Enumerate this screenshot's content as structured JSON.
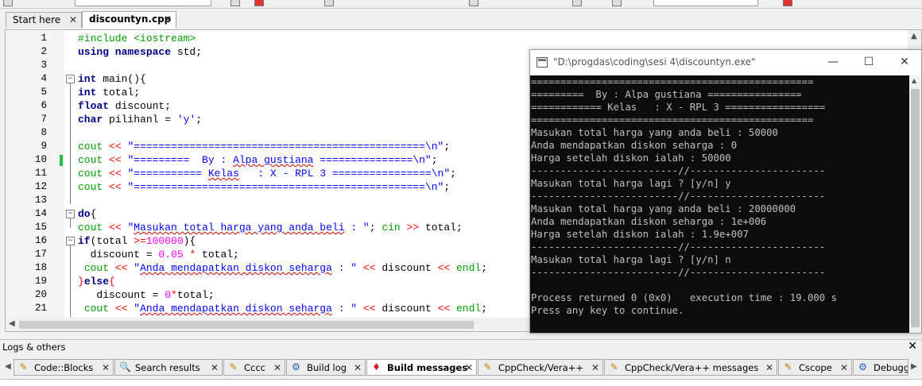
{
  "editor_tabs": [
    {
      "label": "Start here",
      "close": "✕"
    },
    {
      "label": "discountyn.cpp",
      "close": "✕"
    }
  ],
  "line_numbers": [
    "1",
    "2",
    "3",
    "4",
    "5",
    "6",
    "7",
    "8",
    "9",
    "10",
    "11",
    "12",
    "13",
    "14",
    "15",
    "16",
    "17",
    "18",
    "19",
    "20",
    "21"
  ],
  "code": {
    "l1": "#include <iostream>",
    "l2_kw": "using namespace",
    "l2_rest": " std;",
    "l4_kw": "int",
    "l4_rest": " main(){",
    "l5_kw": "int",
    "l5_rest": " total;",
    "l6_kw": "float",
    "l6_rest": " discount;",
    "l7_kw": "char",
    "l7_rest": " pilihanl = ",
    "l7_str": "'y'",
    "l7_end": ";",
    "cout": "cout",
    "ins": " << ",
    "l9_str": "\"===============================================\\n\"",
    "l10_str_a": "\"=========  By : ",
    "l10_sq": "Alpa gustiana",
    "l10_str_b": " ===============\\n\"",
    "l11_str_a": "\"=========== ",
    "l11_sq": "Kelas",
    "l11_str_b": "   : X - RPL 3 ================\\n\"",
    "l12_str": "\"===============================================\\n\"",
    "semi": ";",
    "l14_kw": "do",
    "l14_rest": "{",
    "l15_str_a": "\"",
    "l15_sq": "Masukan total harga yang anda beli",
    "l15_str_b": " : \"",
    "l15_mid": "; ",
    "l15_cin": "cin",
    "l15_ext": " >> ",
    "l15_end": "total;",
    "l16_kw": "if",
    "l16_a": "(total ",
    "l16_op": ">=",
    "l16_num": "100000",
    "l16_b": "){",
    "l17_a": "  discount = ",
    "l17_num": "0.05",
    "l17_op": " * ",
    "l17_b": "total;",
    "l18_pre": " ",
    "l18_str_a": "\"",
    "l18_sq": "Anda mendapatkan diskon seharga",
    "l18_str_b": " : \"",
    "l18_mid": "discount",
    "l18_endl": "endl",
    "l19_a": "}",
    "l19_kw": "else",
    "l19_b": "{",
    "l20_a": "   discount = ",
    "l20_num": "0",
    "l20_op": "*",
    "l20_b": "total;"
  },
  "console": {
    "title": "\"D:\\progdas\\coding\\sesi 4\\discountyn.exe\"",
    "minimize": "—",
    "maximize": "☐",
    "close": "✕",
    "lines": [
      "================================================",
      "=========  By : Alpa gustiana ================",
      "============ Kelas   : X - RPL 3 =================",
      "================================================",
      "Masukan total harga yang anda beli : 50000",
      "Anda mendapatkan diskon seharga : 0",
      "Harga setelah diskon ialah : 50000",
      "-------------------------//-----------------------",
      "Masukan total harga lagi ? [y/n] y",
      "-------------------------//-----------------------",
      "Masukan total harga yang anda beli : 20000000",
      "Anda mendapatkan diskon seharga : 1e+006",
      "Harga setelah diskon ialah : 1.9e+007",
      "-------------------------//-----------------------",
      "Masukan total harga lagi ? [y/n] n",
      "-------------------------//-----------------------",
      "",
      "Process returned 0 (0x0)   execution time : 19.000 s",
      "Press any key to continue."
    ]
  },
  "logs": {
    "title": "Logs & others",
    "close": "✕",
    "tabs": [
      {
        "label": "Code::Blocks",
        "icon": "✎"
      },
      {
        "label": "Search results",
        "icon": "🔍"
      },
      {
        "label": "Cccc",
        "icon": "✎"
      },
      {
        "label": "Build log",
        "icon": "⚙"
      },
      {
        "label": "Build messages",
        "icon": "♦"
      },
      {
        "label": "CppCheck/Vera++",
        "icon": "✎"
      },
      {
        "label": "CppCheck/Vera++ messages",
        "icon": "✎"
      },
      {
        "label": "Cscope",
        "icon": "✎"
      },
      {
        "label": "Debugge",
        "icon": "⚙"
      }
    ],
    "tab_close": "✕",
    "scroll_left": "◀",
    "scroll_right": "▶"
  },
  "colors": {
    "keyword": "#00008b",
    "preprocessor": "#00a000",
    "string": "#0000ff",
    "number": "#ff00ff",
    "operator": "#ff0000",
    "console_bg": "#0c0c0c",
    "console_fg": "#c0c0c0",
    "changebar": "#20c040"
  }
}
